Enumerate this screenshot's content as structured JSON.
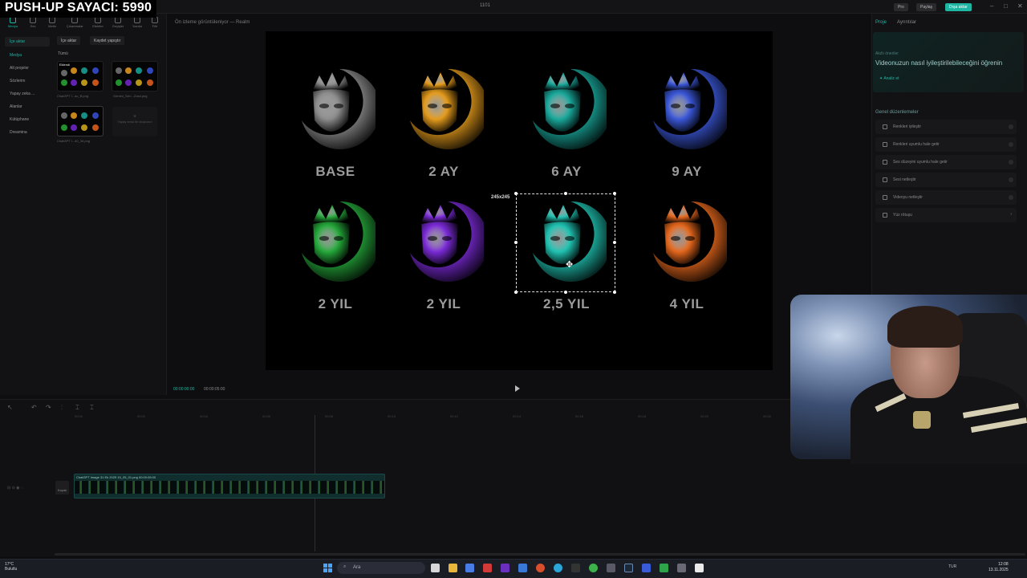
{
  "overlay": {
    "counter": "PUSH-UP SAYACI: 5990"
  },
  "window": {
    "title": "1101",
    "buttons": {
      "pro": "Pro",
      "share": "Paylaş",
      "export": "Dışa aktar"
    }
  },
  "left_panel": {
    "tools": [
      {
        "label": "Medya",
        "active": true
      },
      {
        "label": "Ses"
      },
      {
        "label": "Metin"
      },
      {
        "label": "Çıkartmalar"
      },
      {
        "label": "Efektler"
      },
      {
        "label": "Geçişler"
      },
      {
        "label": "Yazılar"
      },
      {
        "label": "Filtr"
      }
    ],
    "nav": {
      "import_group": "İçe aktar",
      "media": "Medya",
      "sub_projects": "Alt projeler",
      "library": "Sözlerim",
      "ai_generation": "Yapay zeka ...",
      "spaces": "Alanlar",
      "collection": "Kütüphane",
      "dreamina": "Dreamina"
    },
    "chips": {
      "import": "İçe aktar",
      "record": "Kaydet yapıştır"
    },
    "section_all": "Tümü",
    "media_items": [
      {
        "caption": "ChatGPT I...ac_B.png",
        "overlay": "Eklendi"
      },
      {
        "caption": "Gemini_Gen...Zosd.png"
      },
      {
        "caption": "ChatGPT I...40_34.png"
      }
    ],
    "ai_placeholder": "Yapay zeka ile oluşturun"
  },
  "preview": {
    "header_title": "Ön izleme görüntüleniyor — Realm",
    "selection_size": "245x245",
    "time_current": "00:00:00:00",
    "time_total": "00:00:05:00",
    "emblems": [
      {
        "label": "BASE",
        "color": "#8a8a8a"
      },
      {
        "label": "2 AY",
        "color": "#e39a1c"
      },
      {
        "label": "6 AY",
        "color": "#19a79a"
      },
      {
        "label": "9 AY",
        "color": "#3a56d6"
      },
      {
        "label": "2 YIL",
        "color": "#25a83a"
      },
      {
        "label": "2 YIL",
        "color": "#7a2ad6"
      },
      {
        "label": "2,5 YIL",
        "color": "#1fc1b0"
      },
      {
        "label": "4 YIL",
        "color": "#e3661c"
      }
    ]
  },
  "right_panel": {
    "tabs": {
      "project": "Proje",
      "details": "Ayrıntılar"
    },
    "ai": {
      "small_label": "Akıllı öneriler",
      "title": "Videonuzun nasıl iyileştirilebileceğini öğrenin",
      "button": "Analiz et"
    },
    "section": "Genel düzenlemeler",
    "rows": [
      "Renkleri iyileştir",
      "Renkleri uyumlu hale getir",
      "Ses düzeyini uyumlu hale getir",
      "Sesi netleştir",
      "Videoyu netleştir",
      "Yüz rötuşu"
    ]
  },
  "timeline": {
    "clip_label": "ChatGPT Image 31 Ek 2025 15_05_01.png  00:00:05:00",
    "cover_label": "Kapak",
    "ticks": [
      "00:00",
      "00:02",
      "00:04",
      "00:06",
      "00:08",
      "00:10",
      "00:12",
      "00:14",
      "00:16",
      "00:18",
      "00:20",
      "00:22"
    ]
  },
  "taskbar": {
    "weather": "17°C\nBulutlu",
    "search": "Ara",
    "tray": "TUR",
    "time": "12:08",
    "date": "13.11.2025"
  }
}
